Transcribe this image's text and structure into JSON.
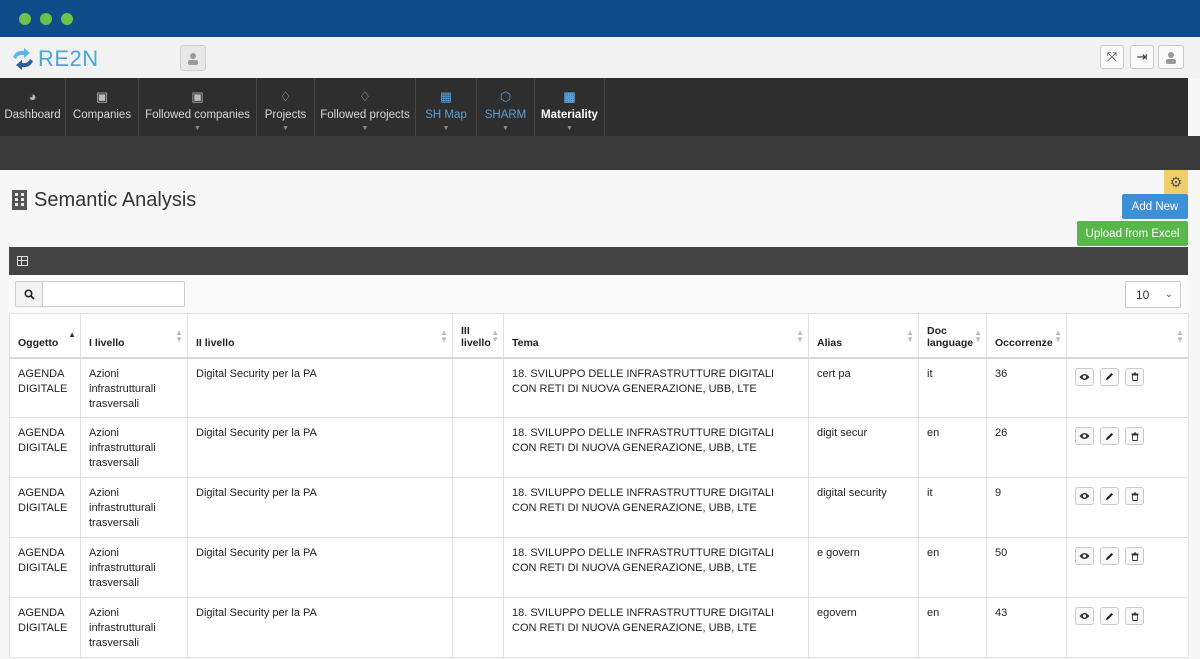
{
  "app": {
    "logo_text": "RE2N"
  },
  "nav": [
    {
      "label": "Dashboard",
      "icon": "dashboard-icon",
      "glyph": "◕"
    },
    {
      "label": "Companies",
      "icon": "briefcase-icon",
      "glyph": "▣"
    },
    {
      "label": "Followed companies",
      "icon": "briefcase-icon",
      "glyph": "▣"
    },
    {
      "label": "Projects",
      "icon": "lightbulb-icon",
      "glyph": "♢"
    },
    {
      "label": "Followed projects",
      "icon": "lightbulb-icon",
      "glyph": "♢"
    },
    {
      "label": "SH Map",
      "icon": "grid-icon",
      "glyph": "▦"
    },
    {
      "label": "SHARM",
      "icon": "cube-icon",
      "glyph": "⬡"
    },
    {
      "label": "Materiality",
      "icon": "grid-icon",
      "glyph": "▦"
    }
  ],
  "page": {
    "title": "Semantic Analysis",
    "add_new_label": "Add New",
    "upload_label": "Upload from Excel"
  },
  "search": {
    "value": "",
    "placeholder": ""
  },
  "page_size": "10",
  "table": {
    "headers": {
      "oggetto": "Oggetto",
      "livello1": "I livello",
      "livello2": "II livello",
      "livello3": "III livello",
      "tema": "Tema",
      "alias": "Alias",
      "doclang": "Doc language",
      "occorrenze": "Occorrenze"
    },
    "rows": [
      {
        "oggetto": "AGENDA DIGITALE",
        "livello1": "Azioni infrastrutturali trasversali",
        "livello2": "Digital Security per la PA",
        "livello3": "",
        "tema": "18. SVILUPPO DELLE INFRASTRUTTURE DIGITALI CON RETI DI NUOVA GENERAZIONE, UBB, LTE",
        "alias": "cert pa",
        "doclang": "it",
        "occorrenze": "36"
      },
      {
        "oggetto": "AGENDA DIGITALE",
        "livello1": "Azioni infrastrutturali trasversali",
        "livello2": "Digital Security per la PA",
        "livello3": "",
        "tema": "18. SVILUPPO DELLE INFRASTRUTTURE DIGITALI CON RETI DI NUOVA GENERAZIONE, UBB, LTE",
        "alias": "digit secur",
        "doclang": "en",
        "occorrenze": "26"
      },
      {
        "oggetto": "AGENDA DIGITALE",
        "livello1": "Azioni infrastrutturali trasversali",
        "livello2": "Digital Security per la PA",
        "livello3": "",
        "tema": "18. SVILUPPO DELLE INFRASTRUTTURE DIGITALI CON RETI DI NUOVA GENERAZIONE, UBB, LTE",
        "alias": "digital security",
        "doclang": "it",
        "occorrenze": "9"
      },
      {
        "oggetto": "AGENDA DIGITALE",
        "livello1": "Azioni infrastrutturali trasversali",
        "livello2": "Digital Security per la PA",
        "livello3": "",
        "tema": "18. SVILUPPO DELLE INFRASTRUTTURE DIGITALI CON RETI DI NUOVA GENERAZIONE, UBB, LTE",
        "alias": "e govern",
        "doclang": "en",
        "occorrenze": "50"
      },
      {
        "oggetto": "AGENDA DIGITALE",
        "livello1": "Azioni infrastrutturali trasversali",
        "livello2": "Digital Security per la PA",
        "livello3": "",
        "tema": "18. SVILUPPO DELLE INFRASTRUTTURE DIGITALI CON RETI DI NUOVA GENERAZIONE, UBB, LTE",
        "alias": "egovern",
        "doclang": "en",
        "occorrenze": "43"
      }
    ]
  }
}
